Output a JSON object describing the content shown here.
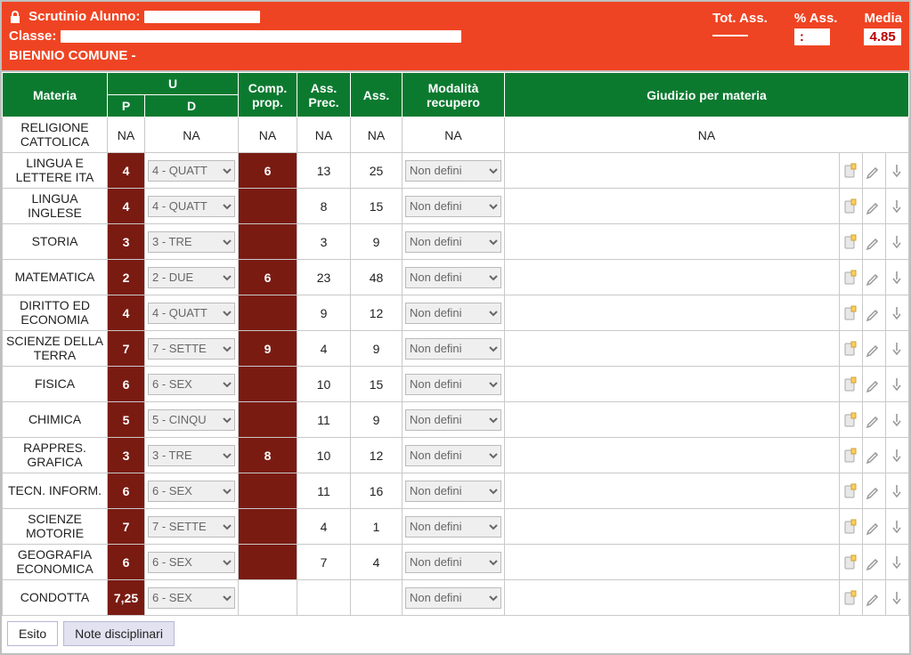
{
  "header": {
    "title_prefix": "Scrutinio Alunno:",
    "classe_label": "Classe:",
    "biennio": "BIENNIO COMUNE -",
    "stats": {
      "tot_ass_label": "Tot. Ass.",
      "tot_ass_val": "",
      "pct_ass_label": "% Ass.",
      "pct_ass_val": ":",
      "media_label": "Media",
      "media_val": "4.85"
    }
  },
  "columns": {
    "materia": "Materia",
    "u": "U",
    "p": "P",
    "d": "D",
    "comp": "Comp. prop.",
    "ass_prec": "Ass. Prec.",
    "ass": "Ass.",
    "mod": "Modalità recupero",
    "giud": "Giudizio per materia"
  },
  "rows": [
    {
      "materia": "RELIGIONE CATTOLICA",
      "na": true,
      "p": "NA",
      "d": "NA",
      "comp": "NA",
      "ass_prec": "NA",
      "ass": "NA",
      "mod": "NA",
      "giud": "NA"
    },
    {
      "materia": "LINGUA E LETTERE ITA",
      "p": "4",
      "d": "4 - QUATT",
      "comp": "6",
      "ass_prec": "13",
      "ass": "25",
      "mod": "Non defini"
    },
    {
      "materia": "LINGUA INGLESE",
      "p": "4",
      "d": "4 - QUATT",
      "comp": "",
      "ass_prec": "8",
      "ass": "15",
      "mod": "Non defini"
    },
    {
      "materia": "STORIA",
      "p": "3",
      "d": "3 - TRE",
      "comp": "",
      "ass_prec": "3",
      "ass": "9",
      "mod": "Non defini"
    },
    {
      "materia": "MATEMATICA",
      "p": "2",
      "d": "2 - DUE",
      "comp": "6",
      "ass_prec": "23",
      "ass": "48",
      "mod": "Non defini"
    },
    {
      "materia": "DIRITTO ED ECONOMIA",
      "p": "4",
      "d": "4 - QUATT",
      "comp": "",
      "ass_prec": "9",
      "ass": "12",
      "mod": "Non defini"
    },
    {
      "materia": "SCIENZE DELLA TERRA",
      "p": "7",
      "d": "7 - SETTE",
      "comp": "9",
      "ass_prec": "4",
      "ass": "9",
      "mod": "Non defini"
    },
    {
      "materia": "FISICA",
      "p": "6",
      "d": "6 - SEX",
      "comp": "",
      "ass_prec": "10",
      "ass": "15",
      "mod": "Non defini"
    },
    {
      "materia": "CHIMICA",
      "p": "5",
      "d": "5 - CINQU",
      "comp": "",
      "ass_prec": "11",
      "ass": "9",
      "mod": "Non defini"
    },
    {
      "materia": "RAPPRES. GRAFICA",
      "p": "3",
      "d": "3 - TRE",
      "comp": "8",
      "ass_prec": "10",
      "ass": "12",
      "mod": "Non defini"
    },
    {
      "materia": "TECN. INFORM.",
      "p": "6",
      "d": "6 - SEX",
      "comp": "",
      "ass_prec": "11",
      "ass": "16",
      "mod": "Non defini"
    },
    {
      "materia": "SCIENZE MOTORIE",
      "p": "7",
      "d": "7 - SETTE",
      "comp": "",
      "ass_prec": "4",
      "ass": "1",
      "mod": "Non defini"
    },
    {
      "materia": "GEOGRAFIA ECONOMICA",
      "p": "6",
      "d": "6 - SEX",
      "comp": "",
      "ass_prec": "7",
      "ass": "4",
      "mod": "Non defini"
    },
    {
      "materia": "CONDOTTA",
      "p": "7,25",
      "d": "6 - SEX",
      "comp": "",
      "ass_prec": "",
      "ass": "",
      "mod": "Non defini",
      "condotta": true
    }
  ],
  "tabs": {
    "esito": "Esito",
    "note": "Note disciplinari"
  },
  "icons": {
    "edit_note": "edit-note-icon",
    "pencil": "pencil-icon",
    "arrow_down": "arrow-down-icon"
  }
}
